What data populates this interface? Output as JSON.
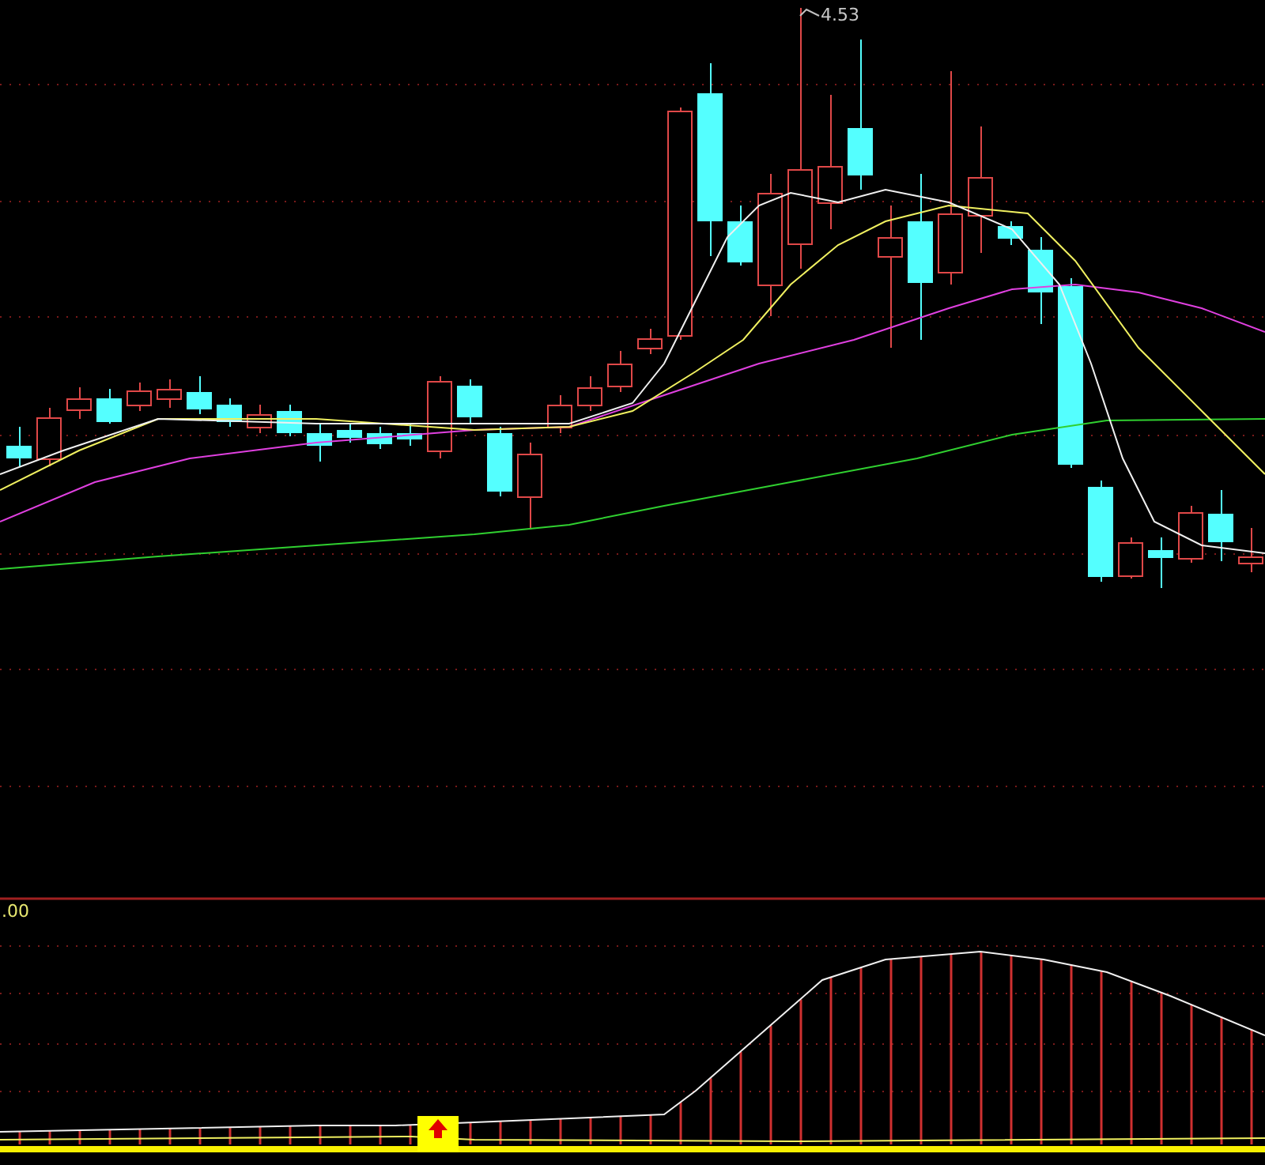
{
  "price_panel": {
    "high_label": "4.53"
  },
  "indicator_panel": {
    "axis_label": ".00"
  }
}
